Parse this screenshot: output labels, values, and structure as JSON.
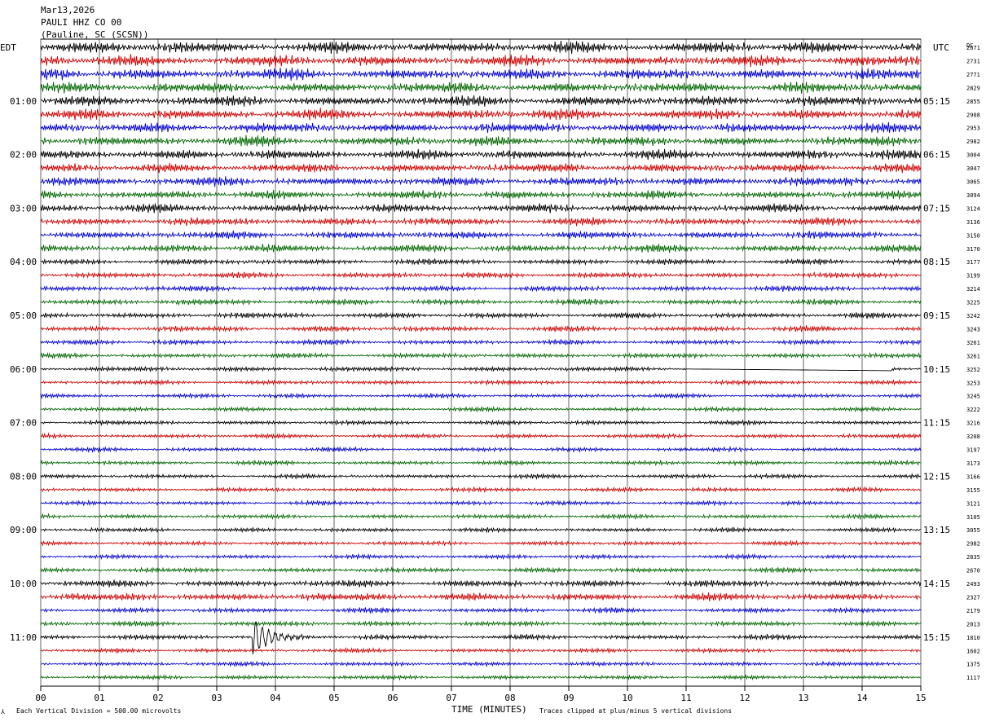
{
  "header": {
    "date": "Mar13,2026",
    "station": "PAULI HHZ CO 00",
    "location": "(Pauline, SC (SCSN))"
  },
  "left_tz": "EDT",
  "right_tz": "UTC",
  "dc_header": "DC",
  "footer": {
    "x_axis_title": "TIME (MINUTES)",
    "scale_note": "Each Vertical Division =  500.00 microvolts",
    "clip_note": "Traces clipped at plus/minus 5 vertical divisions"
  },
  "colors": {
    "cycle": [
      "#000000",
      "#cc0000",
      "#0000cc",
      "#006600"
    ],
    "gridline": "#000000",
    "background": "#ffffff"
  },
  "chart_data": {
    "type": "line",
    "subtype": "helicorder",
    "title": "PAULI HHZ CO 00",
    "xlabel": "TIME (MINUTES)",
    "xlim": [
      0,
      15
    ],
    "x_ticks": [
      "00",
      "01",
      "02",
      "03",
      "04",
      "05",
      "06",
      "07",
      "08",
      "09",
      "10",
      "11",
      "12",
      "13",
      "14",
      "15"
    ],
    "row_count": 48,
    "minutes_per_row": 15,
    "left_labels": [
      {
        "row": 4,
        "text": "01:00"
      },
      {
        "row": 8,
        "text": "02:00"
      },
      {
        "row": 12,
        "text": "03:00"
      },
      {
        "row": 16,
        "text": "04:00"
      },
      {
        "row": 20,
        "text": "05:00"
      },
      {
        "row": 24,
        "text": "06:00"
      },
      {
        "row": 28,
        "text": "07:00"
      },
      {
        "row": 32,
        "text": "08:00"
      },
      {
        "row": 36,
        "text": "09:00"
      },
      {
        "row": 40,
        "text": "10:00"
      },
      {
        "row": 44,
        "text": "11:00"
      }
    ],
    "right_labels": [
      {
        "row": 4,
        "text": "05:15"
      },
      {
        "row": 8,
        "text": "06:15"
      },
      {
        "row": 12,
        "text": "07:15"
      },
      {
        "row": 16,
        "text": "08:15"
      },
      {
        "row": 20,
        "text": "09:15"
      },
      {
        "row": 24,
        "text": "10:15"
      },
      {
        "row": 28,
        "text": "11:15"
      },
      {
        "row": 32,
        "text": "12:15"
      },
      {
        "row": 36,
        "text": "13:15"
      },
      {
        "row": 40,
        "text": "14:15"
      },
      {
        "row": 44,
        "text": "15:15"
      }
    ],
    "dc_offsets": [
      "2671",
      "2731",
      "2771",
      "2829",
      "2855",
      "2908",
      "2953",
      "2982",
      "3004",
      "3047",
      "3065",
      "3094",
      "3124",
      "3136",
      "3150",
      "3170",
      "3177",
      "3199",
      "3214",
      "3225",
      "3242",
      "3243",
      "3261",
      "3261",
      "3252",
      "3253",
      "3245",
      "3222",
      "3216",
      "3208",
      "3197",
      "3173",
      "3166",
      "3155",
      "3121",
      "3105",
      "3055",
      "2982",
      "2835",
      "2670",
      "2493",
      "2327",
      "2179",
      "2013",
      "1810",
      "1602",
      "1375",
      "1117"
    ],
    "row_amplitude_divisions": [
      1.6,
      1.6,
      1.6,
      1.5,
      1.5,
      1.5,
      1.4,
      1.4,
      1.4,
      1.3,
      1.3,
      1.2,
      1.2,
      1.1,
      1.1,
      1.1,
      0.8,
      0.8,
      0.8,
      0.8,
      0.8,
      0.8,
      0.7,
      0.7,
      0.7,
      0.6,
      0.6,
      0.6,
      0.6,
      0.6,
      0.6,
      0.6,
      0.6,
      0.6,
      0.6,
      0.6,
      0.6,
      0.6,
      0.6,
      0.7,
      1.0,
      1.1,
      0.7,
      0.7,
      0.7,
      0.6,
      0.6,
      0.6
    ],
    "events": [
      {
        "row": 44,
        "minute": 3.6,
        "label": "local event, clipped"
      },
      {
        "row": 24,
        "minute_start": 11.0,
        "minute_end": 14.5,
        "label": "data gap"
      }
    ]
  }
}
